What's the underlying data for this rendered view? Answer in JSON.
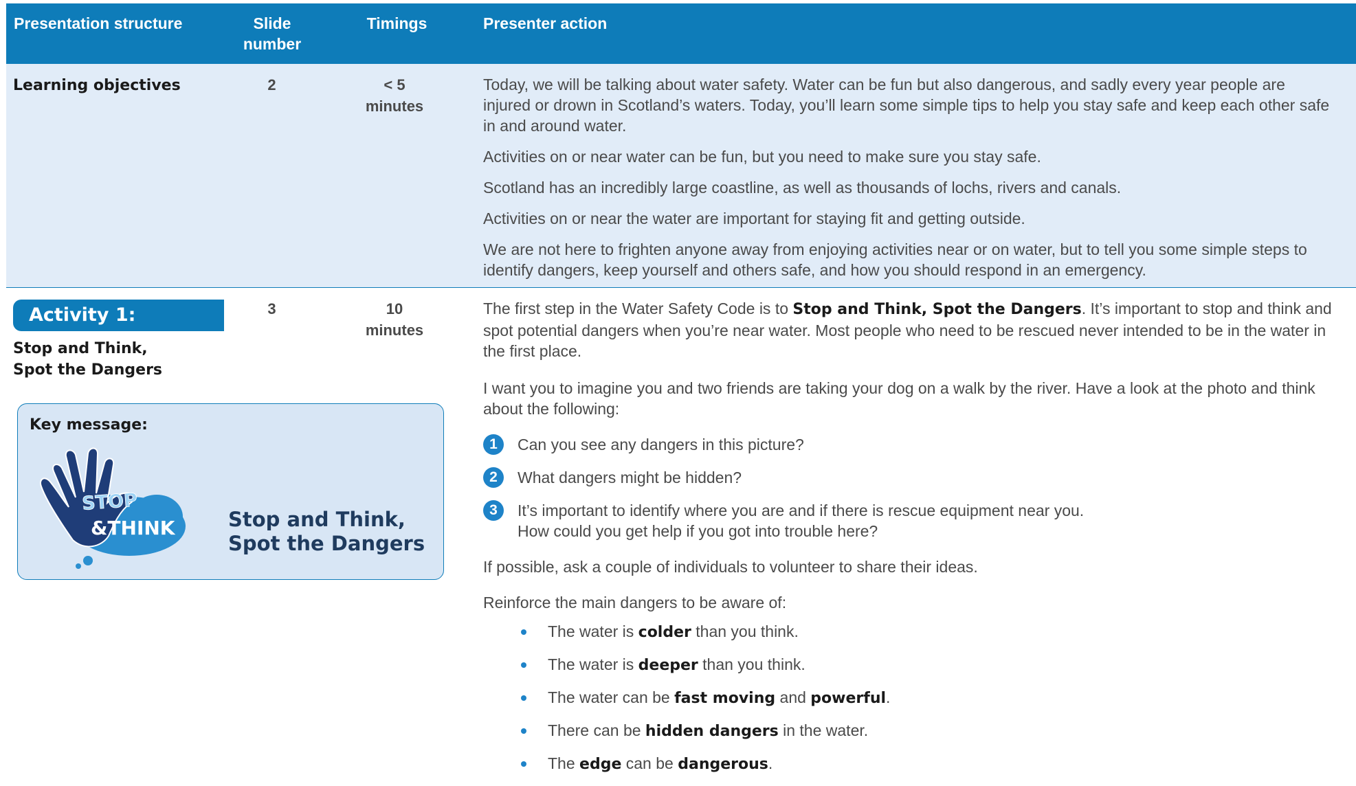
{
  "header": {
    "col1": "Presentation structure",
    "col2": "Slide number",
    "col3": "Timings",
    "col4": "Presenter action"
  },
  "row1": {
    "structure": "Learning objectives",
    "slide": "2",
    "timing": "< 5 minutes",
    "paragraphs": [
      "Today, we will be talking about water safety. Water can be fun but also dangerous, and sadly every year people are injured or drown in Scotland’s waters. Today, you’ll learn some simple tips to help you stay safe and keep each other safe in and around water.",
      "Activities on or near water can be fun, but you need to make sure you stay safe.",
      "Scotland has an incredibly large coastline, as well as thousands of lochs, rivers and canals.",
      "Activities on or near the water are important for staying fit and getting outside.",
      "We are not here to frighten anyone away from enjoying activities near or on water, but to tell you some simple steps to identify dangers, keep yourself and others safe, and how you should respond in an emergency."
    ]
  },
  "row2": {
    "activity_pill": "Activity 1:",
    "activity_title": "Stop and Think, Spot the Dangers",
    "key_message_label": "Key message:",
    "logo_text_1": "STOP",
    "logo_text_2": "&THINK",
    "key_message_text": "Stop and Think, Spot the Dangers",
    "slide": "3",
    "timing": "10 minutes",
    "intro_pre": "The first step in the Water Safety Code is to ",
    "intro_bold": "Stop and Think, Spot the Dangers",
    "intro_post": ". It’s important to stop and think and spot potential dangers when you’re near water. Most people who need to be rescued never intended to be in the water in the first place.",
    "imagine": "I want you to imagine you and two friends are taking your dog on a walk by the river. Have a look at the photo and think about the following:",
    "questions": [
      {
        "n": "1",
        "text": "Can you see any dangers in this picture?"
      },
      {
        "n": "2",
        "text": "What dangers might be hidden?"
      },
      {
        "n": "3",
        "text": "It’s important to identify where you are and if there is rescue equipment near you.",
        "text2": "How could you get help if you got into trouble here?"
      }
    ],
    "volunteer": "If possible, ask a couple of individuals to volunteer to share their ideas.",
    "reinforce": "Reinforce the main dangers to be aware of:",
    "dangers": [
      {
        "a": "The water is ",
        "b": "colder",
        "c": " than you think."
      },
      {
        "a": "The water is ",
        "b": "deeper",
        "c": " than you think."
      },
      {
        "a": "The water can be ",
        "b": "fast moving",
        "c": " and ",
        "d": "powerful",
        "e": "."
      },
      {
        "a": "There can be ",
        "b": "hidden dangers",
        "c": " in the water."
      },
      {
        "a": "The ",
        "b": "edge",
        "c": " can be ",
        "d": "dangerous",
        "e": "."
      }
    ]
  },
  "colors": {
    "header_blue": "#0e7cb9",
    "row_tint": "#e1ecf8",
    "keybox": "#d8e6f5",
    "logo_navy": "#1f3d78",
    "logo_cloud": "#2a8fd0"
  },
  "icons": [
    "hand-stop-icon",
    "cloud-icon",
    "bullet-dot-icon",
    "number-circle-icon"
  ]
}
